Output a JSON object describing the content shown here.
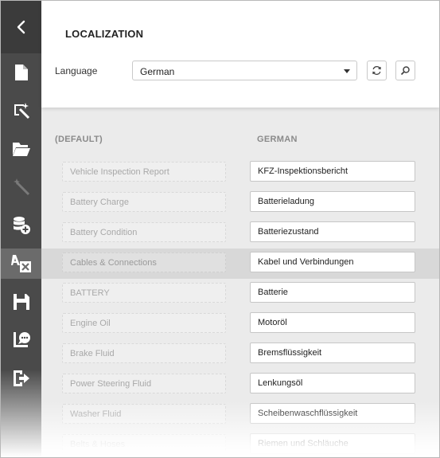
{
  "header": {
    "title": "LOCALIZATION",
    "language_label": "Language",
    "language_selected": "German"
  },
  "sidebar": {
    "items": [
      {
        "icon": "back-chevron-icon"
      },
      {
        "icon": "new-document-icon"
      },
      {
        "icon": "wizard-icon"
      },
      {
        "icon": "open-folder-icon"
      },
      {
        "icon": "magic-wand-icon"
      },
      {
        "icon": "add-data-source-icon"
      },
      {
        "icon": "localization-icon",
        "active": true
      },
      {
        "icon": "save-icon"
      },
      {
        "icon": "script-comments-icon"
      },
      {
        "icon": "exit-icon"
      }
    ]
  },
  "columns": {
    "default": "(DEFAULT)",
    "target": "GERMAN"
  },
  "rows": [
    {
      "source": "Vehicle Inspection Report",
      "translation": "KFZ-Inspektionsbericht"
    },
    {
      "source": "Battery Charge",
      "translation": "Batterieladung"
    },
    {
      "source": "Battery Condition",
      "translation": "Batteriezustand"
    },
    {
      "source": "Cables & Connections",
      "translation": "Kabel und Verbindungen"
    },
    {
      "source": "BATTERY",
      "translation": "Batterie"
    },
    {
      "source": "Engine Oil",
      "translation": "Motoröl"
    },
    {
      "source": "Brake Fluid",
      "translation": "Bremsflüssigkeit"
    },
    {
      "source": "Power Steering Fluid",
      "translation": "Lenkungsöl"
    },
    {
      "source": "Washer Fluid",
      "translation": "Scheibenwaschflüssigkeit"
    },
    {
      "source": "Belts & Hoses",
      "translation": "Riemen und Schläuche"
    }
  ],
  "selected_row_index": 3,
  "colors": {
    "sidebar": "#4a4a4a",
    "sidebar_active": "#6b6b6b",
    "content_bg": "#ebebeb",
    "selected_row": "#d8d8d8"
  }
}
